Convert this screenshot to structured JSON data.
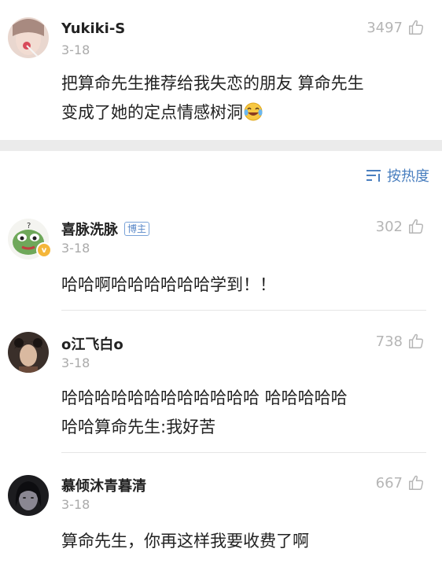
{
  "comments": [
    {
      "username": "Yukiki-S",
      "date": "3-18",
      "likes": "3497",
      "text_line1": "把算命先生推荐给我失恋的朋友 算命先生",
      "text_line2": "变成了她的定点情感树洞",
      "emoji": "laughing-crying-emoji",
      "avatar": "avatar-girl-lollipop"
    },
    {
      "username": "喜脉洗脉",
      "badge": "博主",
      "date": "3-18",
      "likes": "302",
      "text_line1": "哈哈啊哈哈哈哈哈哈学到！！",
      "avatar": "avatar-green-frog",
      "verified": "v"
    },
    {
      "username": "o江飞白o",
      "date": "3-18",
      "likes": "738",
      "text_line1": "哈哈哈哈哈哈哈哈哈哈哈哈 哈哈哈哈哈",
      "text_line2": "哈哈算命先生:我好苦",
      "avatar": "avatar-drama-woman"
    },
    {
      "username": "慕倾沐青暮清",
      "date": "3-18",
      "likes": "667",
      "text_line1": "算命先生，你再这样我要收费了啊",
      "avatar": "avatar-dark-portrait"
    }
  ],
  "sort": {
    "label": "按热度",
    "icon": "sort-icon"
  },
  "colors": {
    "link": "#4a7fbf",
    "muted": "#aaaaaa",
    "band": "#ebebeb"
  }
}
